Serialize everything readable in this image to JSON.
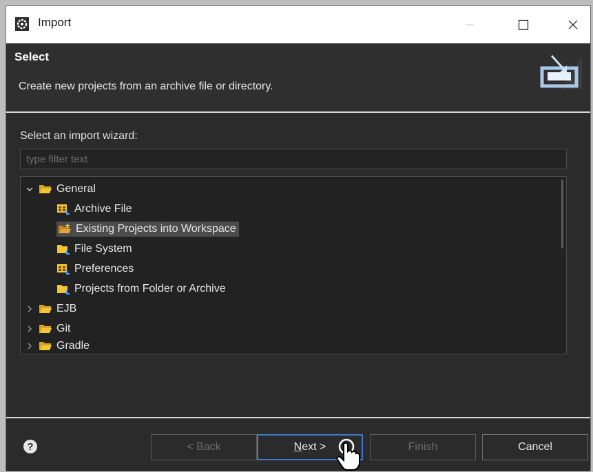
{
  "window": {
    "title": "Import",
    "icon": "gear-icon"
  },
  "titlebar": {
    "minimize_icon": "minimize-icon",
    "maximize_icon": "maximize-icon",
    "close_icon": "close-icon"
  },
  "banner": {
    "title": "Select",
    "description": "Create new projects from an archive file or directory.",
    "icon": "import-wizard-icon"
  },
  "content": {
    "wizard_label": "Select an import wizard:",
    "filter_placeholder": "type filter text",
    "tree": [
      {
        "label": "General",
        "expanded": true,
        "level": 0,
        "icon": "folder-open-icon"
      },
      {
        "label": "Archive File",
        "level": 1,
        "icon": "archive-icon"
      },
      {
        "label": "Existing Projects into Workspace",
        "level": 1,
        "icon": "folder-import-icon",
        "selected": true
      },
      {
        "label": "File System",
        "level": 1,
        "icon": "folder-icon"
      },
      {
        "label": "Preferences",
        "level": 1,
        "icon": "preferences-icon"
      },
      {
        "label": "Projects from Folder or Archive",
        "level": 1,
        "icon": "folder-icon"
      },
      {
        "label": "EJB",
        "expanded": false,
        "level": 0,
        "icon": "folder-open-icon"
      },
      {
        "label": "Git",
        "expanded": false,
        "level": 0,
        "icon": "folder-open-icon"
      },
      {
        "label": "Gradle",
        "expanded": false,
        "level": 0,
        "icon": "folder-open-icon"
      }
    ]
  },
  "footer": {
    "help_label": "?",
    "back_label": "< Back",
    "next_mnemonic": "N",
    "next_rest": "ext >",
    "finish_label": "Finish",
    "cancel_label": "Cancel"
  },
  "colors": {
    "accent": "#3b79c9",
    "selection": "#4c4c4c",
    "folder": "#f4c534"
  }
}
